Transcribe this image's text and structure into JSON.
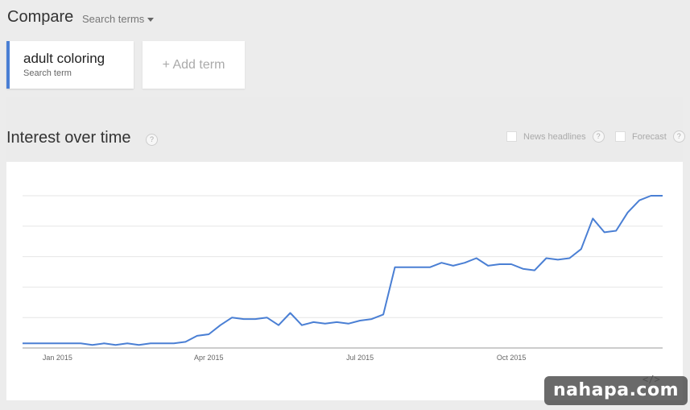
{
  "header": {
    "compare_label": "Compare",
    "search_terms_label": "Search terms"
  },
  "term": {
    "name": "adult coloring",
    "sub": "Search term",
    "accent_color": "#4a7fd4"
  },
  "add_term_label": "+ Add term",
  "section": {
    "title": "Interest over time",
    "help_glyph": "?",
    "news_label": "News headlines",
    "forecast_label": "Forecast"
  },
  "embed_glyph": "</>",
  "watermark_text": "nahapa.com",
  "chart_data": {
    "type": "line",
    "title": "",
    "xlabel": "",
    "ylabel": "",
    "ylim": [
      0,
      100
    ],
    "grid": true,
    "x_ticks": [
      "Jan 2015",
      "Apr 2015",
      "Jul 2015",
      "Oct 2015"
    ],
    "x_tick_index": [
      3,
      16,
      29,
      42
    ],
    "line_color": "#4a7fd4",
    "series": [
      {
        "name": "adult coloring",
        "values": [
          3,
          3,
          3,
          3,
          3,
          3,
          2,
          3,
          2,
          3,
          2,
          3,
          3,
          3,
          4,
          8,
          9,
          15,
          20,
          19,
          19,
          20,
          15,
          23,
          15,
          17,
          16,
          17,
          16,
          18,
          19,
          22,
          53,
          53,
          53,
          53,
          56,
          54,
          56,
          59,
          54,
          55,
          55,
          52,
          51,
          59,
          58,
          59,
          65,
          85,
          76,
          77,
          89,
          97,
          100,
          100
        ]
      }
    ]
  }
}
